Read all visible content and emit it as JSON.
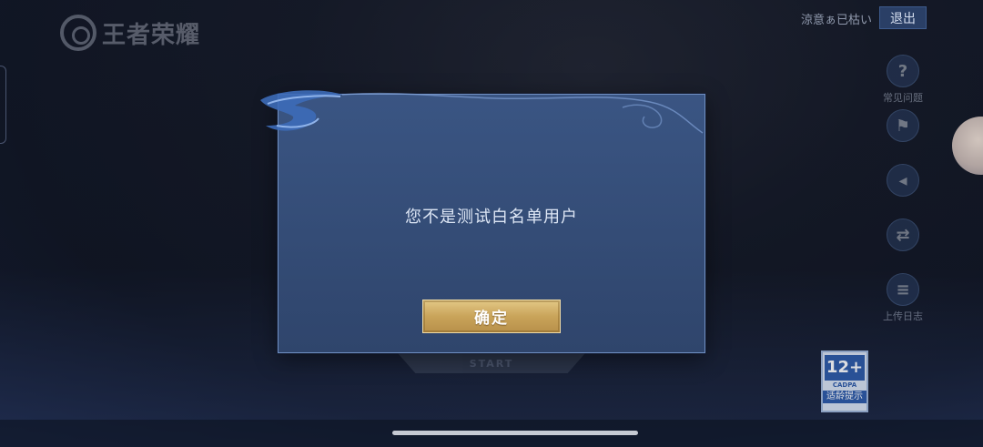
{
  "header": {
    "logo_text": "王者荣耀",
    "user_name": "涼意ぁ已枯い",
    "exit_label": "退出"
  },
  "tools": [
    {
      "icon": "question-icon",
      "glyph": "?",
      "label": "常见问题"
    },
    {
      "icon": "gamepad-icon",
      "glyph": "⚑",
      "label": ""
    },
    {
      "icon": "volume-icon",
      "glyph": "◂",
      "label": ""
    },
    {
      "icon": "device-switch-icon",
      "glyph": "⇄",
      "label": ""
    },
    {
      "icon": "log-upload-icon",
      "glyph": "≡",
      "label": "上传日志"
    }
  ],
  "start": {
    "text": "START"
  },
  "age_badge": {
    "rating": "12+",
    "org": "CADPA",
    "label": "适龄提示"
  },
  "dialog": {
    "message": "您不是测试白名单用户",
    "confirm_label": "确定"
  },
  "colors": {
    "dialog_bg": "#3a5583",
    "confirm_gold": "#c9a45a",
    "exit_bg": "#2a3f66"
  }
}
